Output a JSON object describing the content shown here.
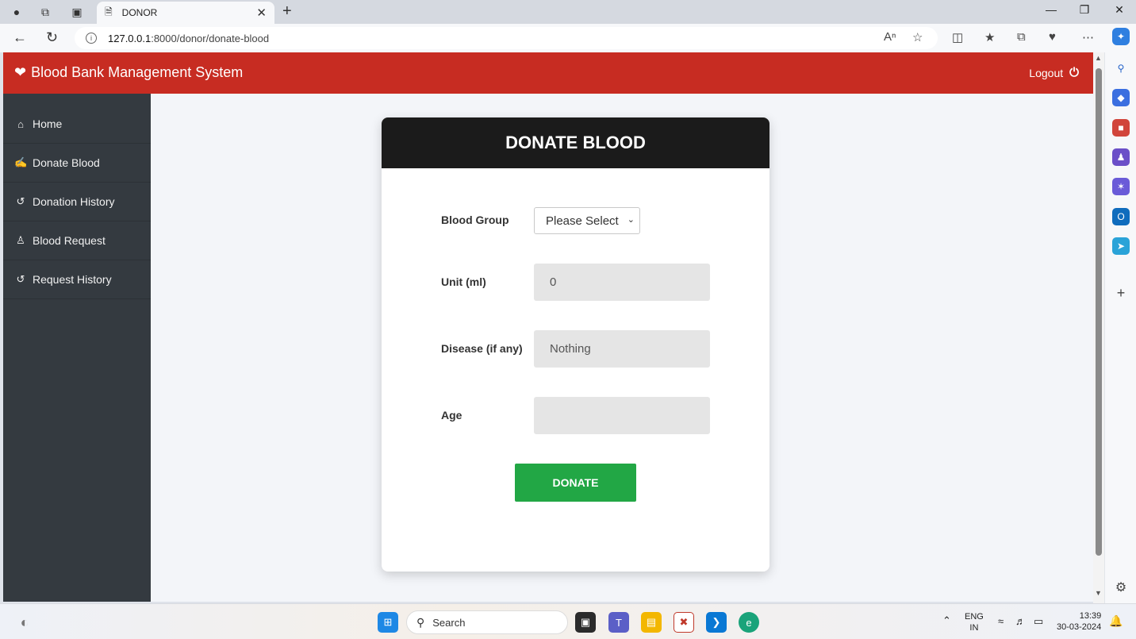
{
  "browser": {
    "tab_title": "DONOR",
    "url_host": "127.0.0.1",
    "url_path": ":8000/donor/donate-blood"
  },
  "app": {
    "brand": "Blood Bank Management System",
    "logout_label": "Logout"
  },
  "sidebar": {
    "items": [
      {
        "label": "Home",
        "icon": "home-icon"
      },
      {
        "label": "Donate Blood",
        "icon": "hand-holding-icon"
      },
      {
        "label": "Donation History",
        "icon": "history-icon"
      },
      {
        "label": "Blood Request",
        "icon": "user-plus-icon"
      },
      {
        "label": "Request History",
        "icon": "history-icon"
      }
    ]
  },
  "form": {
    "title": "DONATE BLOOD",
    "blood_group_label": "Blood Group",
    "blood_group_value": "Please Select",
    "unit_label": "Unit (ml)",
    "unit_value": "0",
    "disease_label": "Disease (if any)",
    "disease_value": "Nothing",
    "age_label": "Age",
    "age_value": "",
    "submit_label": "DONATE"
  },
  "taskbar": {
    "search_label": "Search",
    "lang_line1": "ENG",
    "lang_line2": "IN",
    "time": "13:39",
    "date": "30-03-2024"
  },
  "colors": {
    "header": "#c72c22",
    "sidebar": "#343a40",
    "card_header": "#1b1b1b",
    "donate_button": "#22a745"
  }
}
